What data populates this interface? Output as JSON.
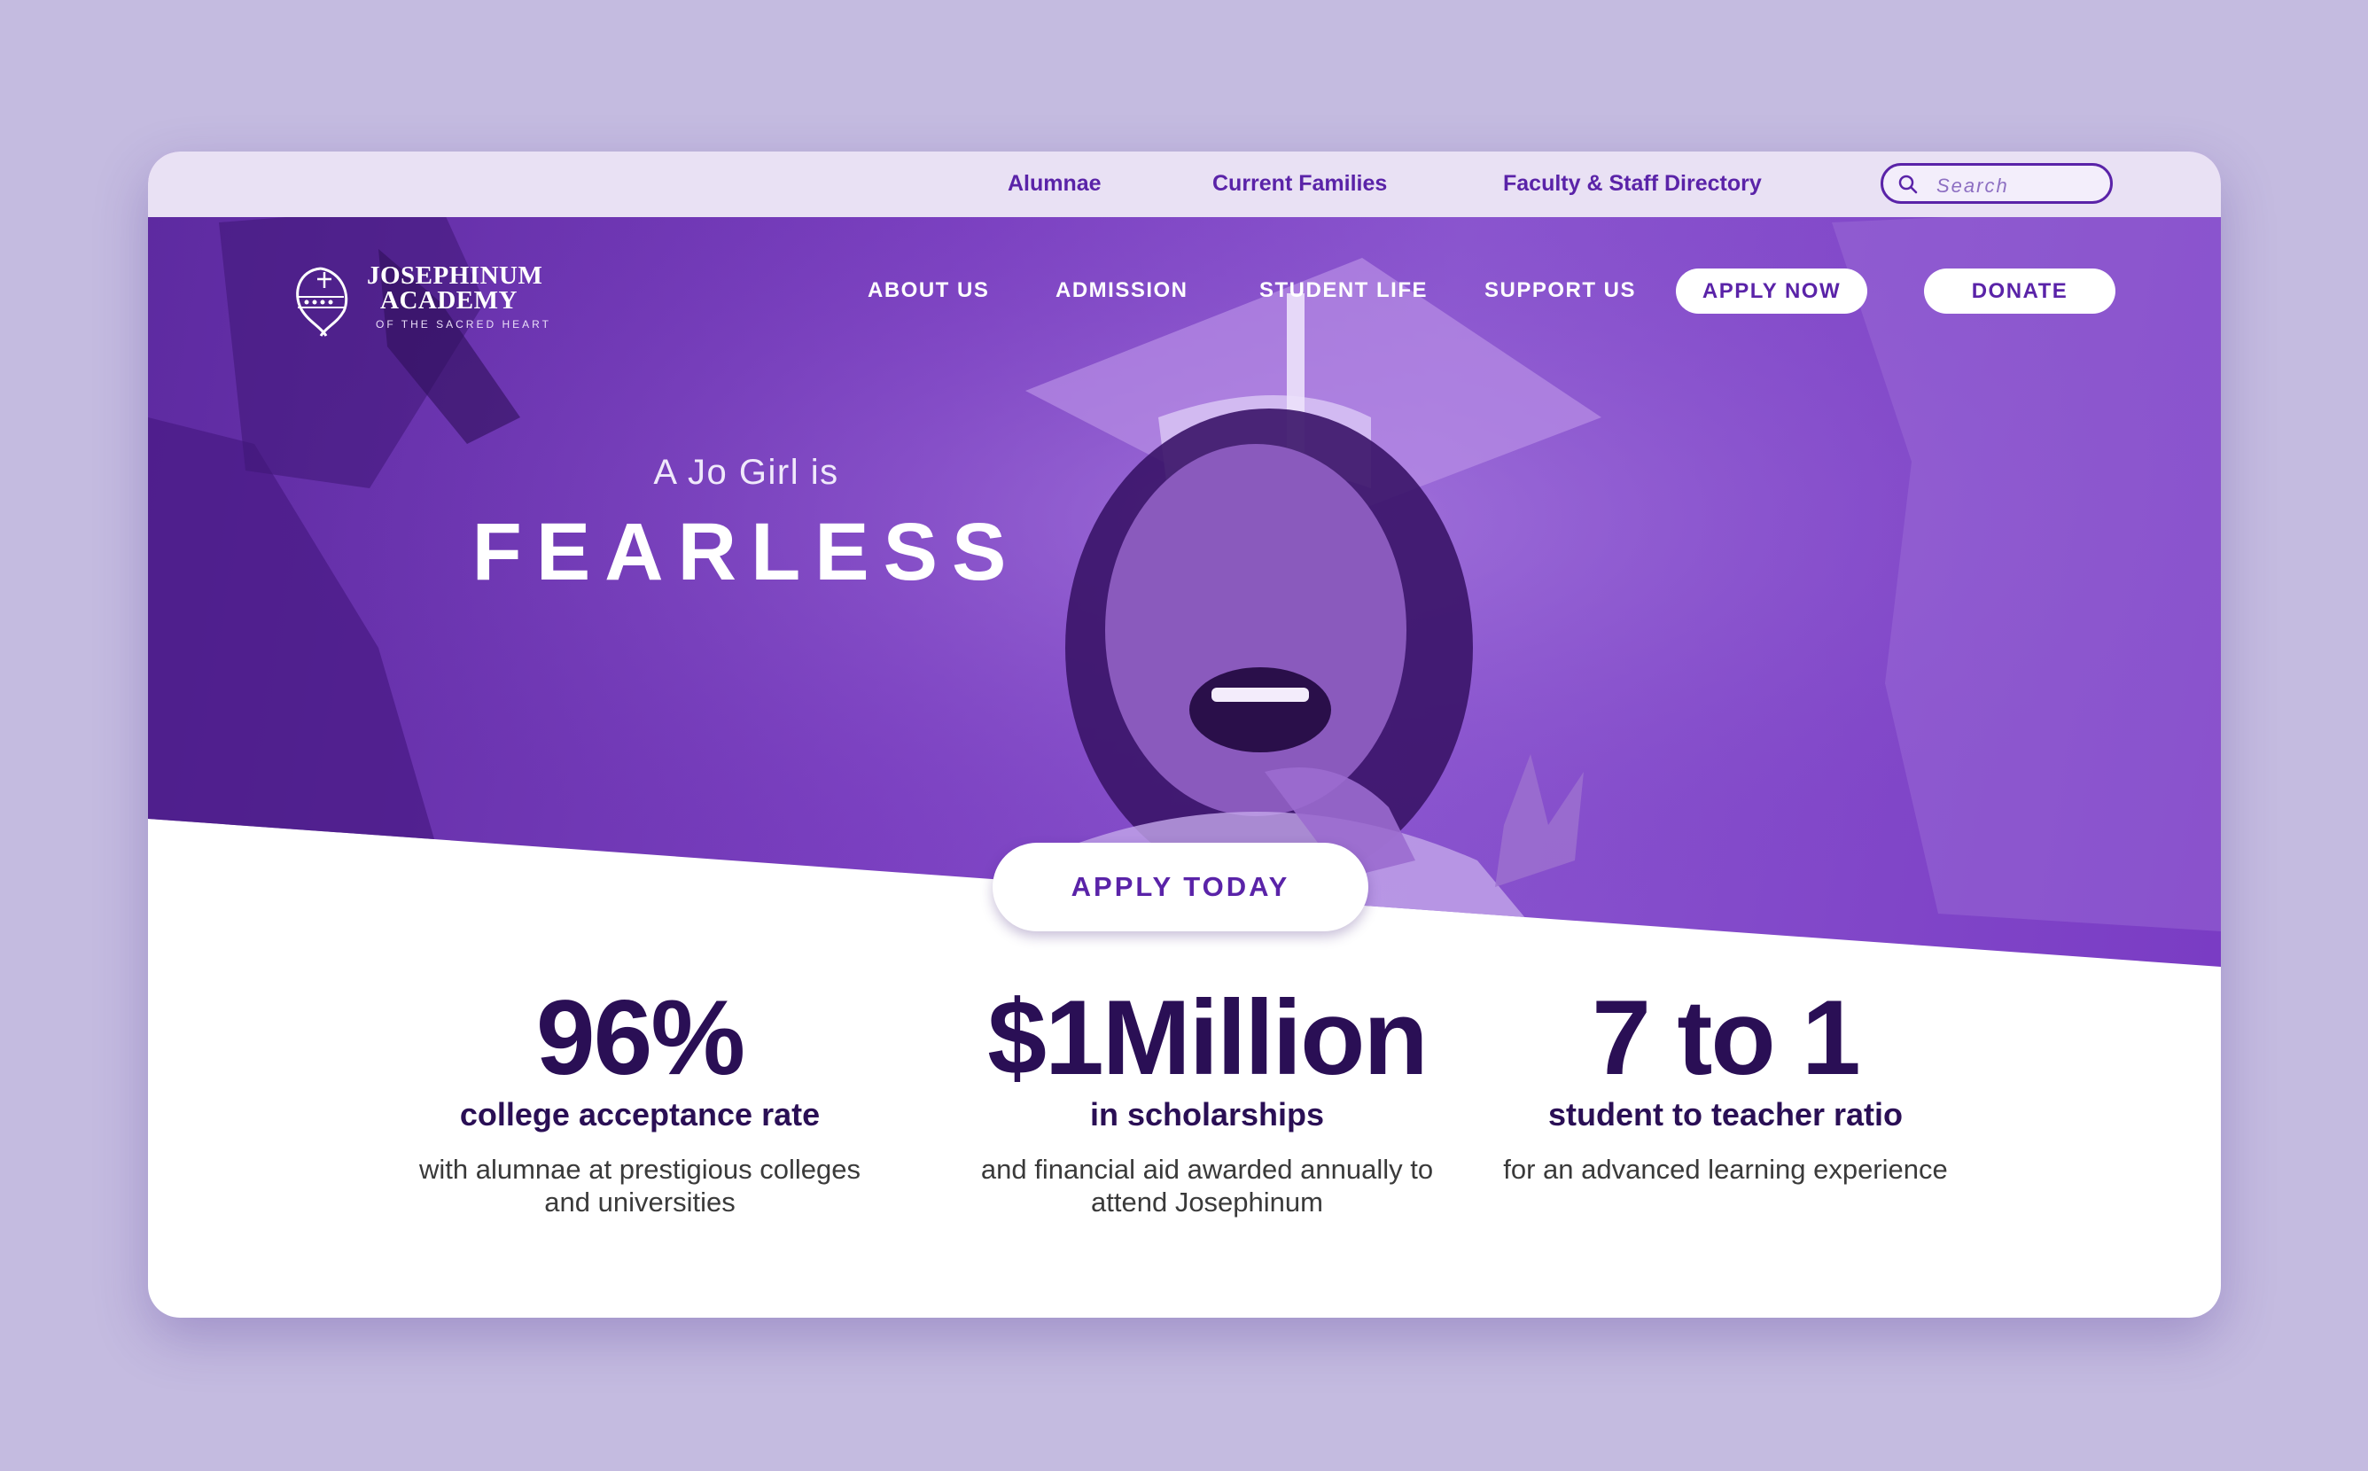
{
  "utility_nav": {
    "alumnae": "Alumnae",
    "current_families": "Current Families",
    "directory": "Faculty & Staff Directory",
    "search_placeholder": "Search"
  },
  "logo": {
    "line1": "JOSEPHINUM",
    "line2": "ACADEMY",
    "sub": "OF THE SACRED HEART"
  },
  "main_nav": {
    "about": "ABOUT US",
    "admission": "ADMISSION",
    "student_life": "STUDENT LIFE",
    "support": "SUPPORT US",
    "apply_now": "APPLY NOW",
    "donate": "DONATE"
  },
  "hero": {
    "subtitle": "A Jo Girl is",
    "title": "FEARLESS",
    "cta": "APPLY TODAY"
  },
  "stats": [
    {
      "big": "96%",
      "label": "college acceptance rate",
      "desc": "with alumnae at prestigious colleges and universities"
    },
    {
      "big": "$1Million",
      "label": "in scholarships",
      "desc": "and financial aid awarded annually to attend Josephinum"
    },
    {
      "big": "7 to 1",
      "label": "student to teacher ratio",
      "desc": "for an advanced learning experience"
    }
  ],
  "colors": {
    "page_bg": "#c4bbe0",
    "brand_purple": "#5a23a8",
    "dark_purple": "#2a0f55",
    "hero_overlay": "#7a3fc0"
  }
}
